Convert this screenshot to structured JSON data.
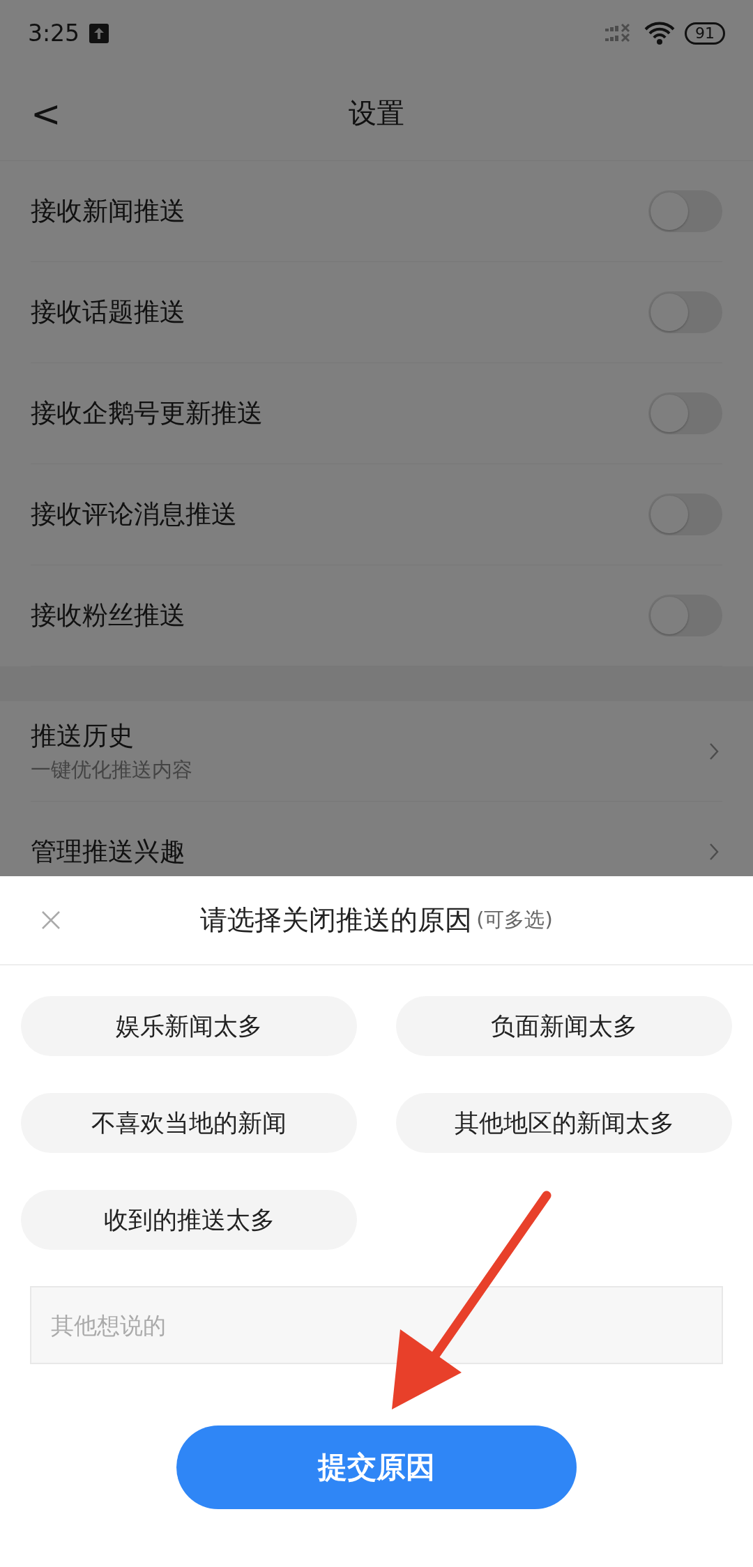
{
  "status_bar": {
    "time": "3:25",
    "battery": "91"
  },
  "header": {
    "back": "<",
    "title": "设置"
  },
  "toggles": [
    {
      "label": "接收新闻推送",
      "on": false
    },
    {
      "label": "接收话题推送",
      "on": false
    },
    {
      "label": "接收企鹅号更新推送",
      "on": false
    },
    {
      "label": "接收评论消息推送",
      "on": false
    },
    {
      "label": "接收粉丝推送",
      "on": false
    }
  ],
  "links": [
    {
      "title": "推送历史",
      "subtitle": "一键优化推送内容"
    },
    {
      "title": "管理推送兴趣"
    }
  ],
  "sheet": {
    "title": "请选择关闭推送的原因",
    "hint": "(可多选)",
    "reasons": [
      {
        "label": "娱乐新闻太多",
        "selected": false
      },
      {
        "label": "负面新闻太多",
        "selected": false
      },
      {
        "label": "不喜欢当地的新闻",
        "selected": false
      },
      {
        "label": "其他地区的新闻太多",
        "selected": false
      },
      {
        "label": "收到的推送太多",
        "selected": false
      }
    ],
    "input": {
      "placeholder": "其他想说的"
    },
    "submit": "提交原因"
  }
}
